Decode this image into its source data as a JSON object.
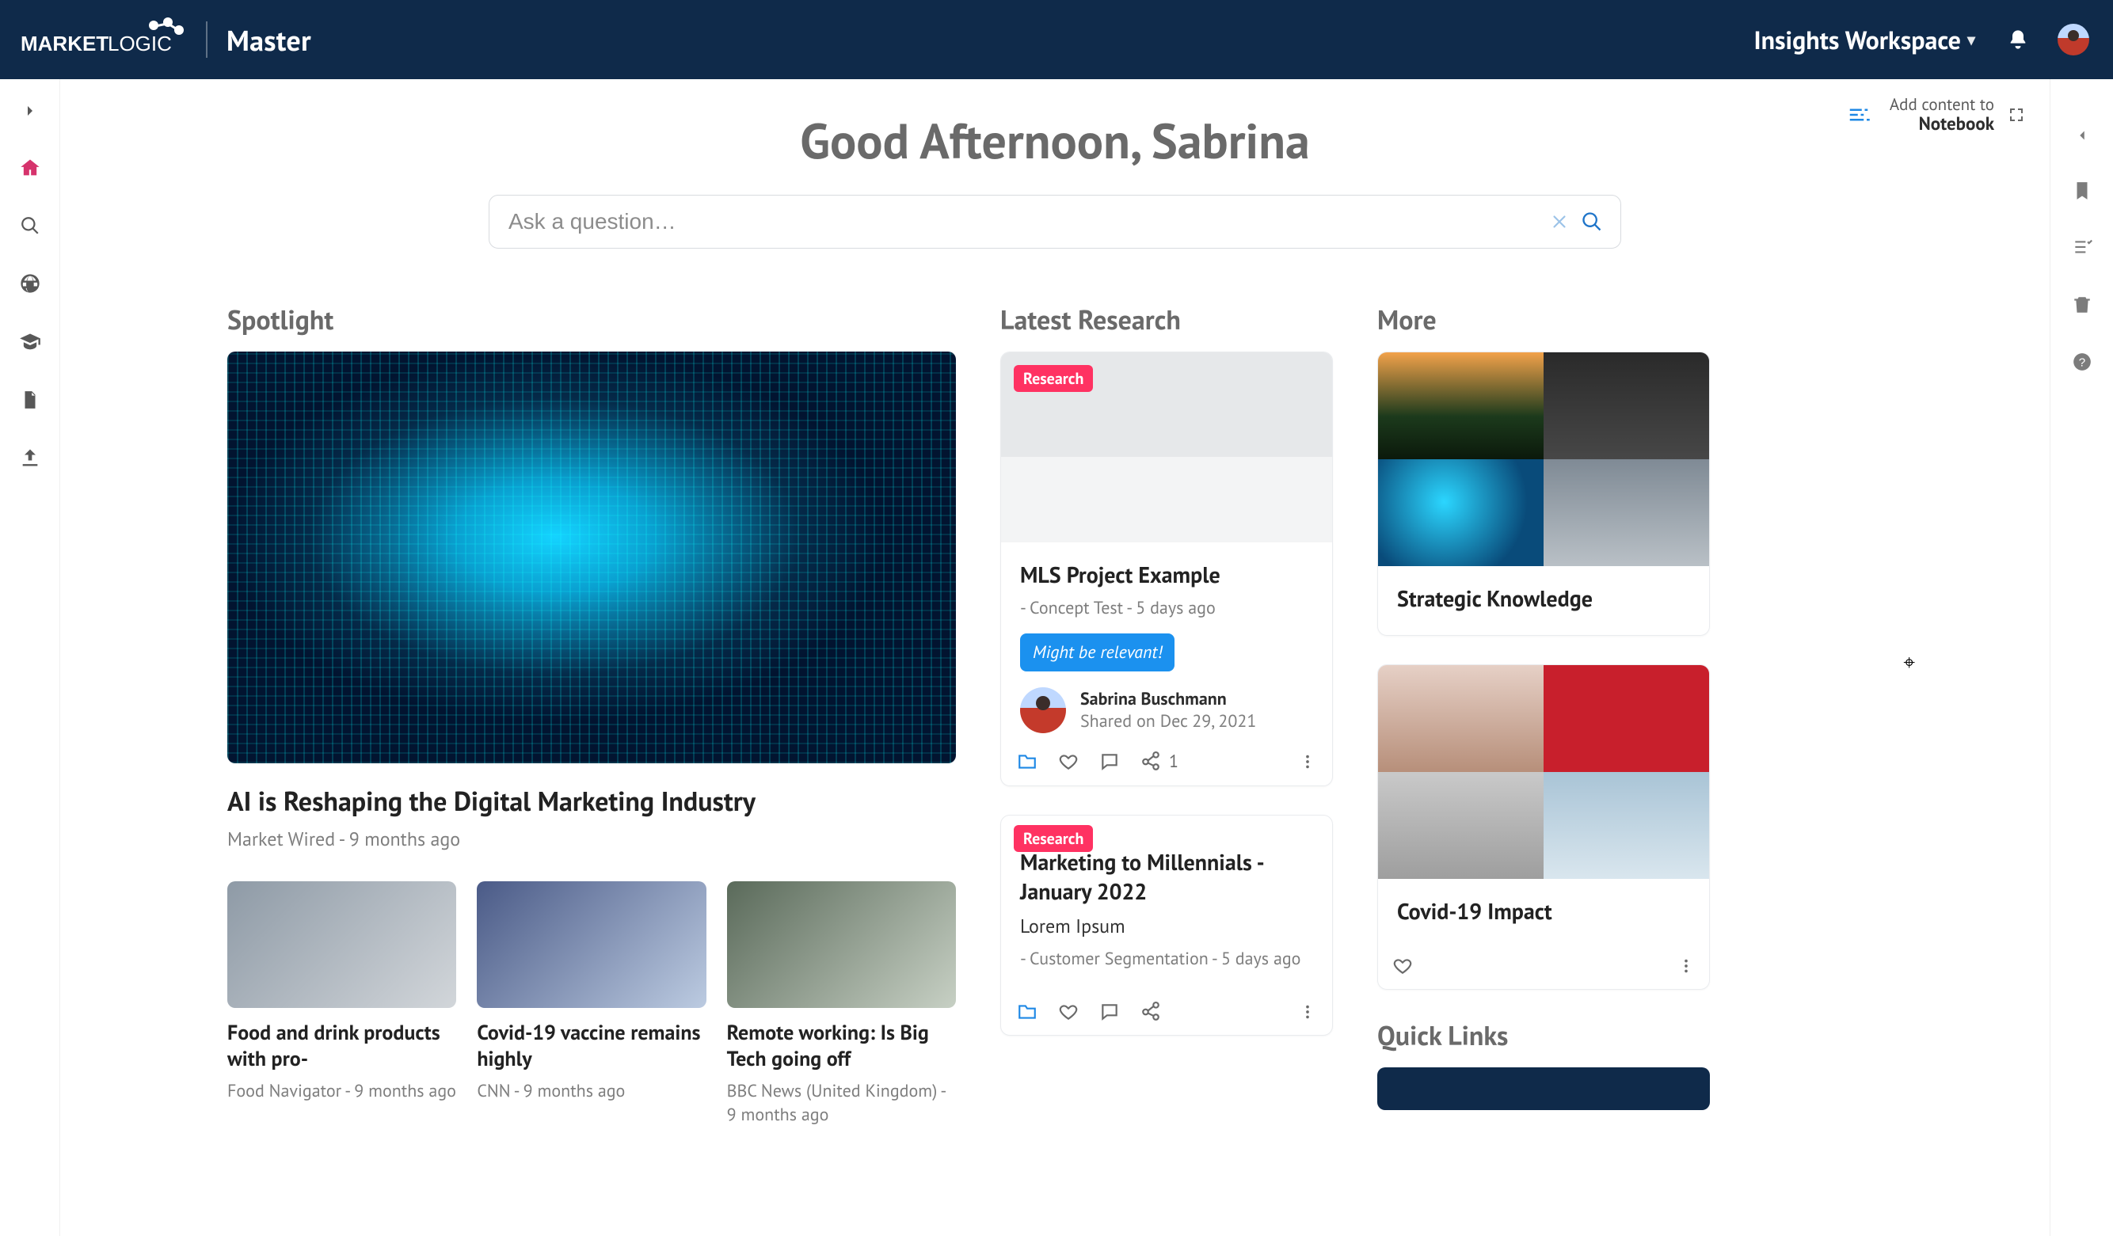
{
  "header": {
    "brand_primary": "MARKET",
    "brand_secondary": "LOGIC",
    "tenant": "Master",
    "workspace_label": "Insights Workspace"
  },
  "topbar": {
    "add_line1": "Add content to",
    "add_line2": "Notebook"
  },
  "greeting": "Good Afternoon, Sabrina",
  "search": {
    "placeholder": "Ask a question…"
  },
  "sections": {
    "spotlight": "Spotlight",
    "latest_research": "Latest Research",
    "more": "More",
    "quick_links": "Quick Links"
  },
  "spotlight": {
    "hero": {
      "title": "AI is Reshaping the Digital Marketing Industry",
      "meta": "Market Wired - 9 months ago"
    },
    "minis": [
      {
        "title": "Food and drink products with pro-",
        "meta": "Food Navigator - 9 months ago"
      },
      {
        "title": "Covid-19 vaccine remains highly",
        "meta": "CNN - 9 months ago"
      },
      {
        "title": "Remote working: Is Big Tech going off",
        "meta": "BBC News (United Kingdom) - 9 months ago"
      }
    ]
  },
  "latest_research": [
    {
      "badge": "Research",
      "title": "MLS Project Example",
      "meta": "- Concept Test - 5 days ago",
      "tag": "Might be relevant!",
      "author": "Sabrina Buschmann",
      "shared": "Shared on Dec 29, 2021",
      "share_count": "1"
    },
    {
      "badge": "Research",
      "title": "Marketing to Millennials - January 2022",
      "desc": "Lorem Ipsum",
      "meta": "- Customer Segmentation - 5 days ago"
    }
  ],
  "more": [
    {
      "title": "Strategic Knowledge"
    },
    {
      "title": "Covid-19 Impact"
    }
  ]
}
